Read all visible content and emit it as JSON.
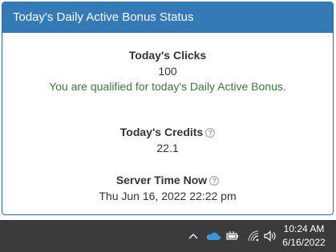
{
  "panel": {
    "title": "Today's Daily Active Bonus Status"
  },
  "clicks": {
    "label": "Today's Clicks",
    "value": "100",
    "status_message": "You are qualified for today's Daily Active Bonus."
  },
  "credits": {
    "label": "Today's Credits",
    "value": "22.1",
    "help_icon": "?"
  },
  "server_time": {
    "label": "Server Time Now",
    "value": "Thu Jun 16, 2022 22:22 pm",
    "help_icon": "?"
  },
  "taskbar": {
    "time": "10:24 AM",
    "date": "6/16/2022",
    "icons": [
      "chevron-up-icon",
      "onedrive-cloud-icon",
      "battery-icon",
      "wifi-icon",
      "speaker-icon"
    ]
  },
  "colors": {
    "header_bg": "#337ab7",
    "success_text": "#3c763d",
    "taskbar_bg": "#3b3b3b"
  }
}
